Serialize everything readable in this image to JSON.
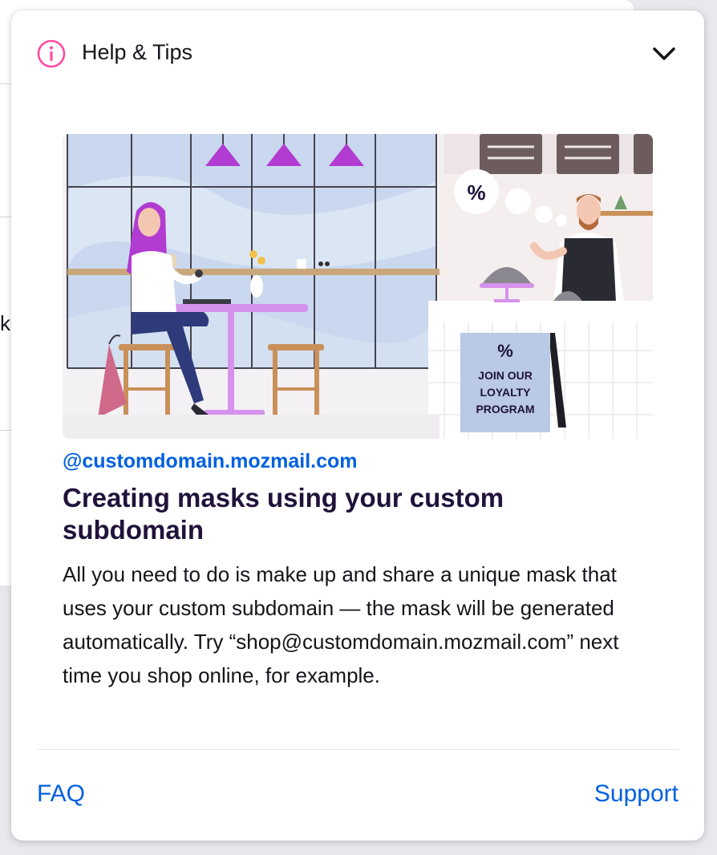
{
  "background": {
    "partial_text": "k"
  },
  "panel": {
    "title": "Help & Tips",
    "icons": {
      "info": "info-icon",
      "collapse": "chevron-down-icon"
    },
    "colors": {
      "info_icon": "#ff4aa2",
      "link": "#0060df",
      "heading": "#20123a"
    }
  },
  "tip": {
    "domain": "@customdomain.mozmail.com",
    "title": "Creating masks using your custom subdomain",
    "body": "All you need to do is make up and share a unique mask that uses your custom subdomain — the mask will be generated automatically. Try “shop@customdomain.mozmail.com” next time you shop online, for example.",
    "illustration": {
      "sign_percent": "%",
      "sign_line1": "JOIN OUR",
      "sign_line2": "LOYALTY",
      "sign_line3": "PROGRAM",
      "bubble_percent": "%"
    }
  },
  "footer": {
    "faq_label": "FAQ",
    "support_label": "Support"
  }
}
